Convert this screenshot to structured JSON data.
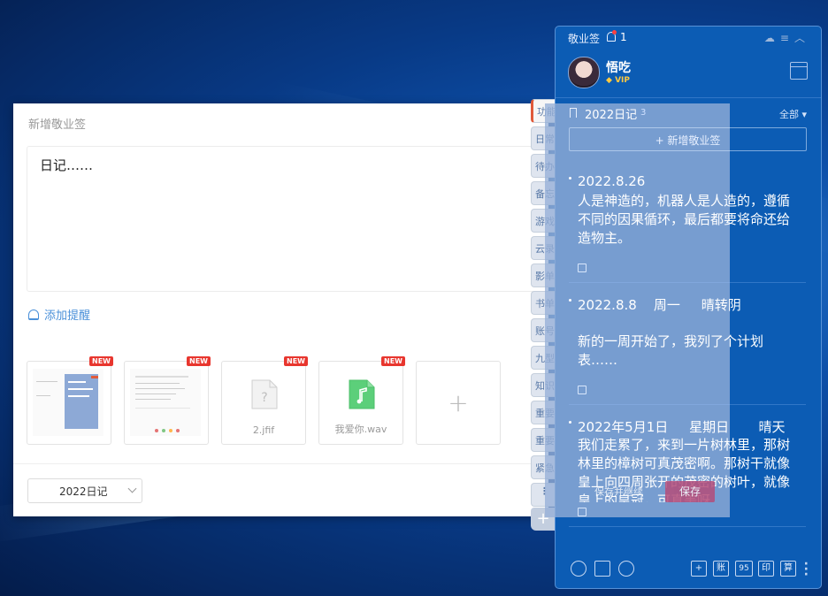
{
  "editor": {
    "title": "新增敬业签",
    "content": "日记……",
    "reminder_label": "添加提醒",
    "new_badge": "NEW",
    "attachments": [
      {
        "name": "",
        "type": "image"
      },
      {
        "name": "",
        "type": "image"
      },
      {
        "name": "2.jfif",
        "type": "file"
      },
      {
        "name": "我爱你.wav",
        "type": "audio"
      }
    ],
    "add_attachment": "+",
    "category": "2022日记",
    "save_hint": "保存并继续",
    "save_label": "保存"
  },
  "tabs": [
    "功能",
    "日常",
    "待办",
    "备忘",
    "游戏",
    "云录",
    "影单",
    "书单",
    "账号",
    "九型",
    "知识",
    "重要",
    "重要",
    "紧急"
  ],
  "tabs_more": "⋮",
  "tabs_add": "+",
  "panel": {
    "app_name": "敬业签",
    "reminder_count": "1",
    "user": {
      "name": "悟吃",
      "badge": "VIP"
    },
    "list_title": "2022日记",
    "list_count": "3",
    "filter": "全部",
    "new_note": "+ 新增敬业签",
    "notes": [
      {
        "title": "2022.8.26",
        "body": "人是神造的，机器人是人造的，遵循不同的因果循环，最后都要将命还给造物主。"
      },
      {
        "title": "2022.8.8    周一     晴转阴",
        "body": "\n新的一周开始了，我列了个计划表……"
      },
      {
        "title": "2022年5月1日     星期日       晴天",
        "body": "我们走累了，来到一片树林里，那树林里的樟树可真茂密啊。那树干就像皇上向四周张开的茂密的树叶，就像皇上的皇冠，可真美呀"
      }
    ],
    "bottom": {
      "ledger": "账",
      "num": "95",
      "print": "印",
      "calc": "算",
      "add": "+"
    }
  },
  "colors": {
    "panel_bg": "#0c5cb4",
    "accent_link": "#4a90d9",
    "new_badge": "#e8362e",
    "vip": "#ffc940"
  }
}
